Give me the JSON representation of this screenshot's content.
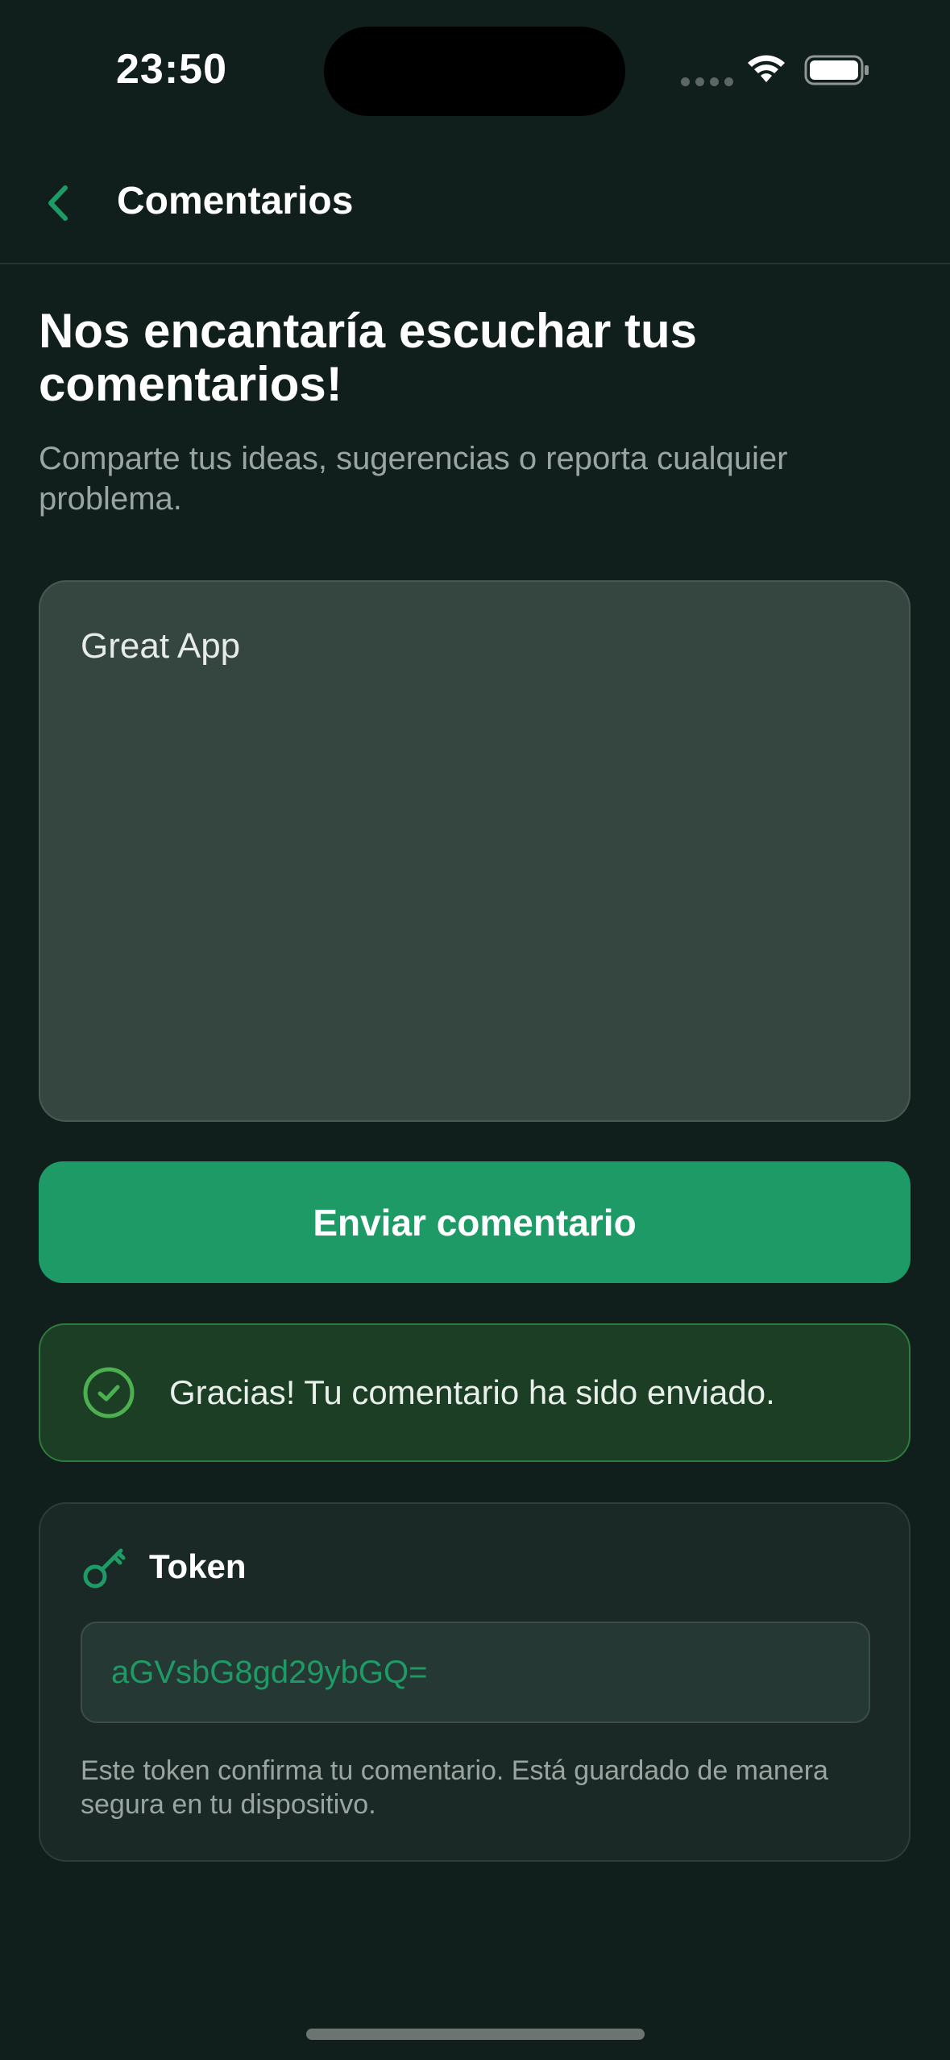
{
  "status_bar": {
    "time": "23:50"
  },
  "nav": {
    "title": "Comentarios",
    "back_icon": "chevron-left-icon"
  },
  "header": {
    "title": "Nos encantaría escuchar tus comentarios!",
    "subtitle": "Comparte tus ideas, sugerencias o reporta cualquier problema."
  },
  "feedback": {
    "value": "Great App"
  },
  "submit": {
    "label": "Enviar comentario"
  },
  "success": {
    "icon": "check-circle-icon",
    "message": "Gracias! Tu comentario ha sido enviado."
  },
  "token": {
    "icon": "key-icon",
    "title": "Token",
    "value": "aGVsbG8gd29ybGQ=",
    "note": "Este token confirma tu comentario. Está guardado de manera segura en tu dispositivo."
  },
  "colors": {
    "background": "#101f1c",
    "accent": "#1e9a66",
    "success_border": "#2f7a3d",
    "success_icon": "#4caf50"
  }
}
